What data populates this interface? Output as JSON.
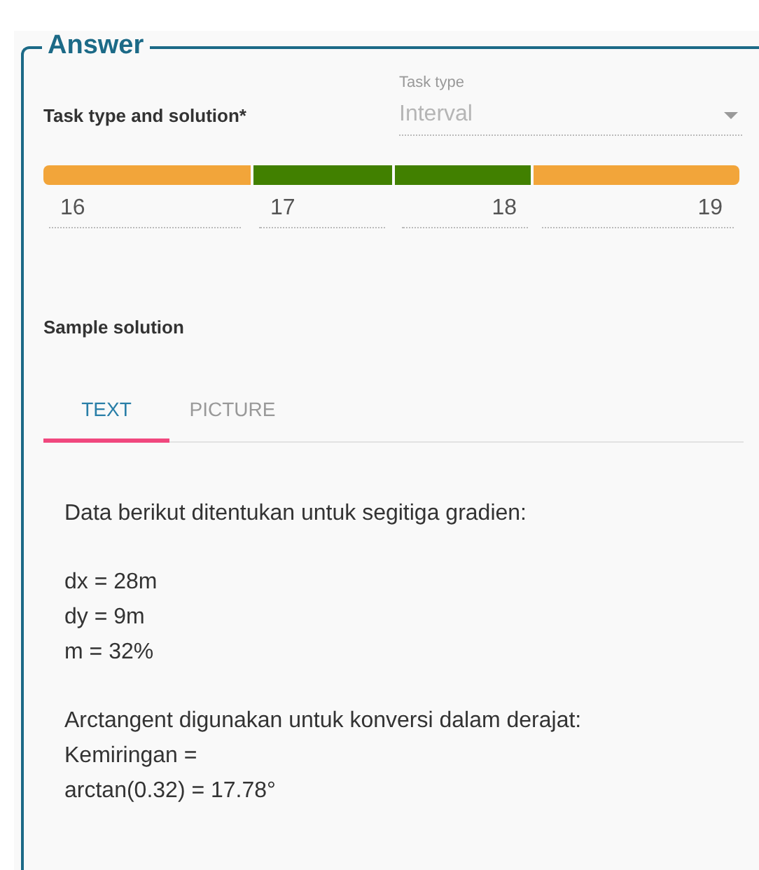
{
  "section_title": "Answer",
  "task_type_label": "Task type and solution*",
  "task_type_select": {
    "label": "Task type",
    "value": "Interval",
    "disabled": true
  },
  "interval_bar": [
    {
      "color": "#f2a53a"
    },
    {
      "color": "#418000"
    },
    {
      "color": "#418000"
    },
    {
      "color": "#f2a53a"
    }
  ],
  "interval_fields": [
    {
      "value": "16"
    },
    {
      "value": "17"
    },
    {
      "value": "18"
    },
    {
      "value": "19"
    }
  ],
  "sample_solution_label": "Sample solution",
  "tabs": [
    {
      "label": "TEXT",
      "selected": true
    },
    {
      "label": "PICTURE",
      "selected": false
    }
  ],
  "solution_paragraphs": [
    [
      "Data berikut ditentukan untuk segitiga gradien:"
    ],
    [
      "dx = 28m",
      "dy = 9m",
      "m = 32%"
    ],
    [
      "Arctangent digunakan untuk konversi dalam derajat:",
      "Kemiringan =",
      "arctan(0.32) = 17.78°"
    ]
  ]
}
